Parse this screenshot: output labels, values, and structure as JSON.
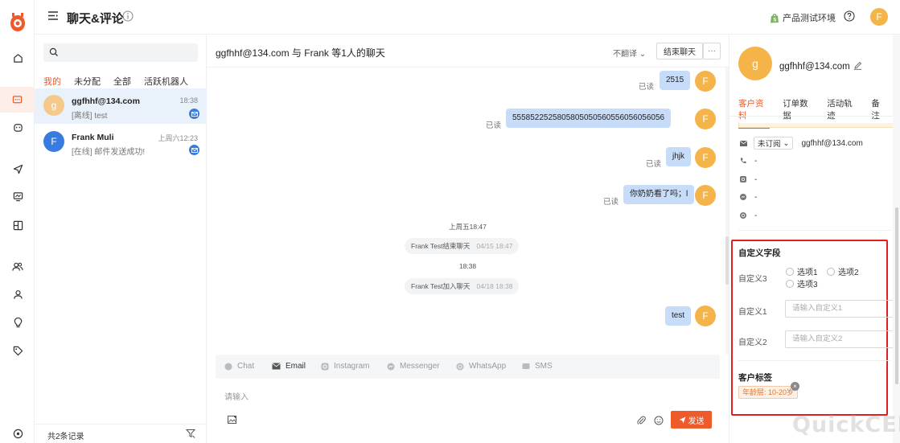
{
  "header": {
    "title": "聊天&评论",
    "env_label": "产品测试环境",
    "user_initial": "F"
  },
  "colors": {
    "accent": "#ee5a2a",
    "bubble": "#c7dcf8",
    "avatar_orange": "#f5b44a",
    "avatar_blue": "#3a7be0",
    "highlight_box": "#e02020"
  },
  "sidebar": {
    "icons": [
      "home-icon",
      "chat-icon",
      "bot-icon",
      "send-icon",
      "monitor-icon",
      "widget-icon",
      "team-icon",
      "user-icon",
      "bulb-icon",
      "tag-icon",
      "settings-icon"
    ]
  },
  "list": {
    "search_placeholder": "",
    "tabs": [
      "我的",
      "未分配",
      "全部",
      "活跃机器人"
    ],
    "conversations": [
      {
        "initial": "g",
        "name": "ggfhhf@134.com",
        "time": "18:38",
        "preview": "[离线] test",
        "color": "#f5c98a"
      },
      {
        "initial": "F",
        "name": "Frank Muli",
        "time": "上周六12:23",
        "preview": "[在线] 邮件发送成功!",
        "color": "#3a7be0"
      }
    ],
    "total": "共2条记录"
  },
  "chat": {
    "title": "ggfhhf@134.com 与 Frank 等1人的聊天",
    "translate": "不翻译",
    "end_button": "结束聊天",
    "more": "···",
    "avatar_initial": "F",
    "read_label": "已读",
    "messages": [
      {
        "text": "2515",
        "read": "已读"
      },
      {
        "text": "5558522525805805050560556056056056",
        "read": "已读"
      },
      {
        "text": "jhjk",
        "read": "已读"
      },
      {
        "text": "你奶奶看了吗；l",
        "read": "已读"
      },
      {
        "text": "test"
      }
    ],
    "time_1": "上周五18:47",
    "system_1": {
      "text": "Frank Test结束聊天",
      "time": "04/15 18:47"
    },
    "time_2": "18:38",
    "system_2": {
      "text": "Frank Test加入聊天",
      "time": "04/18 18:38"
    },
    "channels": [
      "Chat",
      "Email",
      "Instagram",
      "Messenger",
      "WhatsApp",
      "SMS"
    ],
    "active_channel": "Email",
    "input_placeholder": "请输入",
    "send_button": "发送"
  },
  "profile": {
    "initial": "g",
    "name": "ggfhhf@134.com",
    "tabs": [
      "客户资料",
      "订单数据",
      "活动轨迹",
      "备注"
    ],
    "subscribe_status": "未订阅",
    "email": "ggfhhf@134.com",
    "phone": "-",
    "instagram": "-",
    "messenger": "-",
    "whatsapp": "-",
    "custom_fields_title": "自定义字段",
    "custom3_label": "自定义3",
    "custom3_options": [
      "选项1",
      "选项2",
      "选项3"
    ],
    "custom1_label": "自定义1",
    "custom1_placeholder": "请输入自定义1",
    "custom2_label": "自定义2",
    "custom2_placeholder": "请输入自定义2",
    "tags_title": "客户标签",
    "tag": "年龄层: 10-20岁"
  },
  "watermark": "QuickCEP"
}
